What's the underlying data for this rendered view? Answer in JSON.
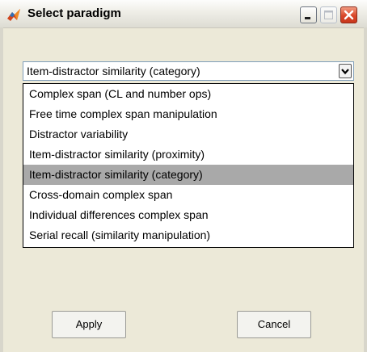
{
  "window": {
    "title": "Select paradigm"
  },
  "paradigm_select": {
    "value": "Item-distractor similarity (category)",
    "options": [
      "Complex span (CL and number ops)",
      "Free time complex span manipulation",
      "Distractor variability",
      "Item-distractor similarity (proximity)",
      "Item-distractor similarity (category)",
      "Cross-domain complex span",
      "Individual differences complex span",
      "Serial recall (similarity manipulation)"
    ],
    "selected_index": 4
  },
  "buttons": {
    "apply": "Apply",
    "cancel": "Cancel"
  },
  "colors": {
    "highlight": "#a9a9a9",
    "window_bg": "#ece9d8",
    "close_button": "#d9472a"
  }
}
